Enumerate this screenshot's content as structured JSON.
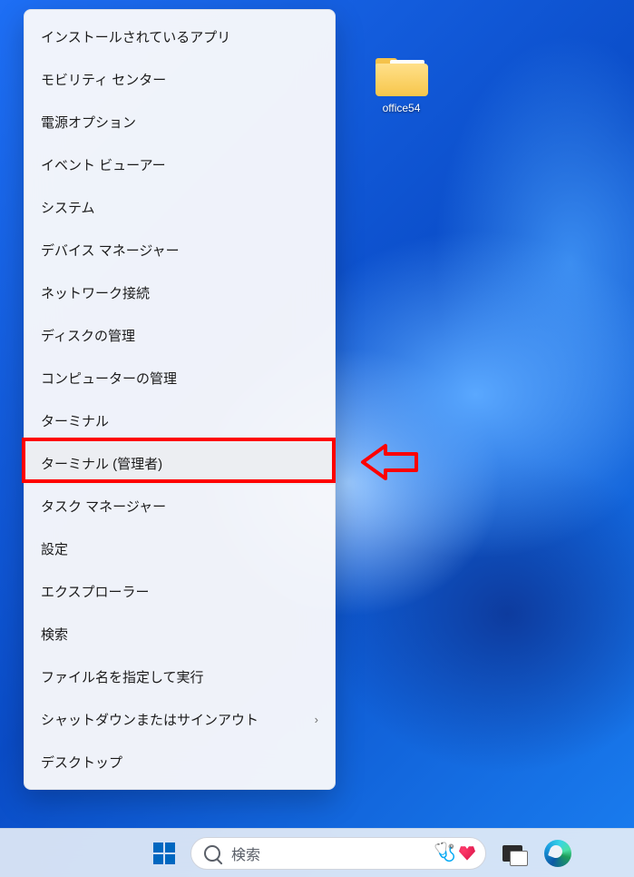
{
  "desktop": {
    "icons": [
      {
        "label": "office54"
      }
    ]
  },
  "context_menu": {
    "items": [
      {
        "label": "インストールされているアプリ",
        "submenu": false
      },
      {
        "label": "モビリティ センター",
        "submenu": false
      },
      {
        "label": "電源オプション",
        "submenu": false
      },
      {
        "label": "イベント ビューアー",
        "submenu": false
      },
      {
        "label": "システム",
        "submenu": false
      },
      {
        "label": "デバイス マネージャー",
        "submenu": false
      },
      {
        "label": "ネットワーク接続",
        "submenu": false
      },
      {
        "label": "ディスクの管理",
        "submenu": false
      },
      {
        "label": "コンピューターの管理",
        "submenu": false
      },
      {
        "label": "ターミナル",
        "submenu": false
      },
      {
        "label": "ターミナル (管理者)",
        "submenu": false,
        "highlighted": true
      },
      {
        "label": "タスク マネージャー",
        "submenu": false
      },
      {
        "label": "設定",
        "submenu": false
      },
      {
        "label": "エクスプローラー",
        "submenu": false
      },
      {
        "label": "検索",
        "submenu": false
      },
      {
        "label": "ファイル名を指定して実行",
        "submenu": false
      },
      {
        "label": "シャットダウンまたはサインアウト",
        "submenu": true
      },
      {
        "label": "デスクトップ",
        "submenu": false
      }
    ]
  },
  "taskbar": {
    "search_placeholder": "検索"
  },
  "annotation": {
    "highlight_color": "#ff0000"
  }
}
